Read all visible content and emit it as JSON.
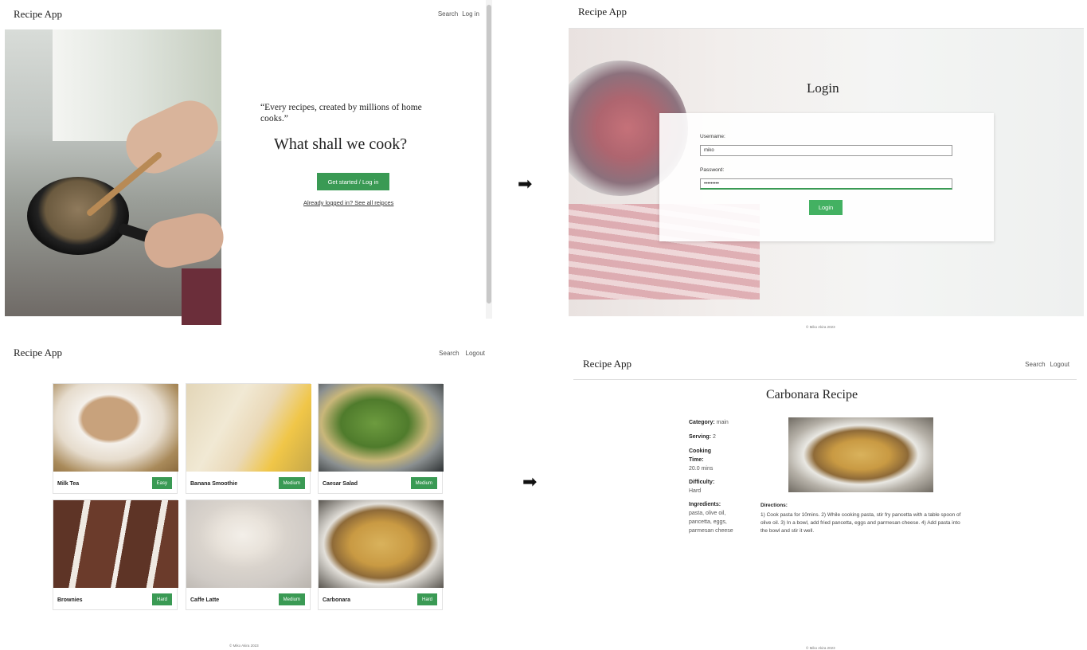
{
  "landing": {
    "brand": "Recipe App",
    "nav": [
      "Search",
      "Log in"
    ],
    "quote": "“Every recipes, created by millions of home cooks.”",
    "headline": "What shall we cook?",
    "cta": "Get started / Log in",
    "link": "Already logged in? See all reipces"
  },
  "login": {
    "brand": "Recipe App",
    "title": "Login",
    "username_label": "Username:",
    "username_value": "miko",
    "password_label": "Password:",
    "password_value": "•••••••••",
    "button": "Login",
    "footer": "© Miko Akira 2023"
  },
  "grid": {
    "brand": "Recipe App",
    "nav": [
      "Search",
      "Logout"
    ],
    "recipes": [
      {
        "name": "Milk Tea",
        "difficulty": "Easy"
      },
      {
        "name": "Banana Smoothie",
        "difficulty": "Medium"
      },
      {
        "name": "Caesar Salad",
        "difficulty": "Medium"
      },
      {
        "name": "Brownies",
        "difficulty": "Hard"
      },
      {
        "name": "Caffe Latte",
        "difficulty": "Medium"
      },
      {
        "name": "Carbonara",
        "difficulty": "Hard"
      }
    ],
    "footer": "© Miko Akira 2023"
  },
  "detail": {
    "brand": "Recipe App",
    "nav": [
      "Search",
      "Logout"
    ],
    "title": "Carbonara Recipe",
    "category_label": "Category:",
    "category": "main",
    "serving_label": "Serving:",
    "serving": "2",
    "cooking_time_label": "Cooking Time:",
    "cooking_time": "20.0 mins",
    "difficulty_label": "Difficulty:",
    "difficulty": "Hard",
    "ingredients_label": "Ingredients:",
    "ingredients": "pasta, olive oil, pancetta, eggs, parmesan cheese",
    "directions_label": "Directions:",
    "directions": "1) Cook pasta for 10mins. 2) While cooking pasta, stir fry pancetta with a table spoon of olive oil. 3) In a bowl, add fried pancetta, eggs and parmesan cheese. 4) Add pasta into the bowl and stir it well.",
    "footer": "© Miko Akira 2023"
  },
  "arrows": [
    "➡",
    "➡"
  ]
}
